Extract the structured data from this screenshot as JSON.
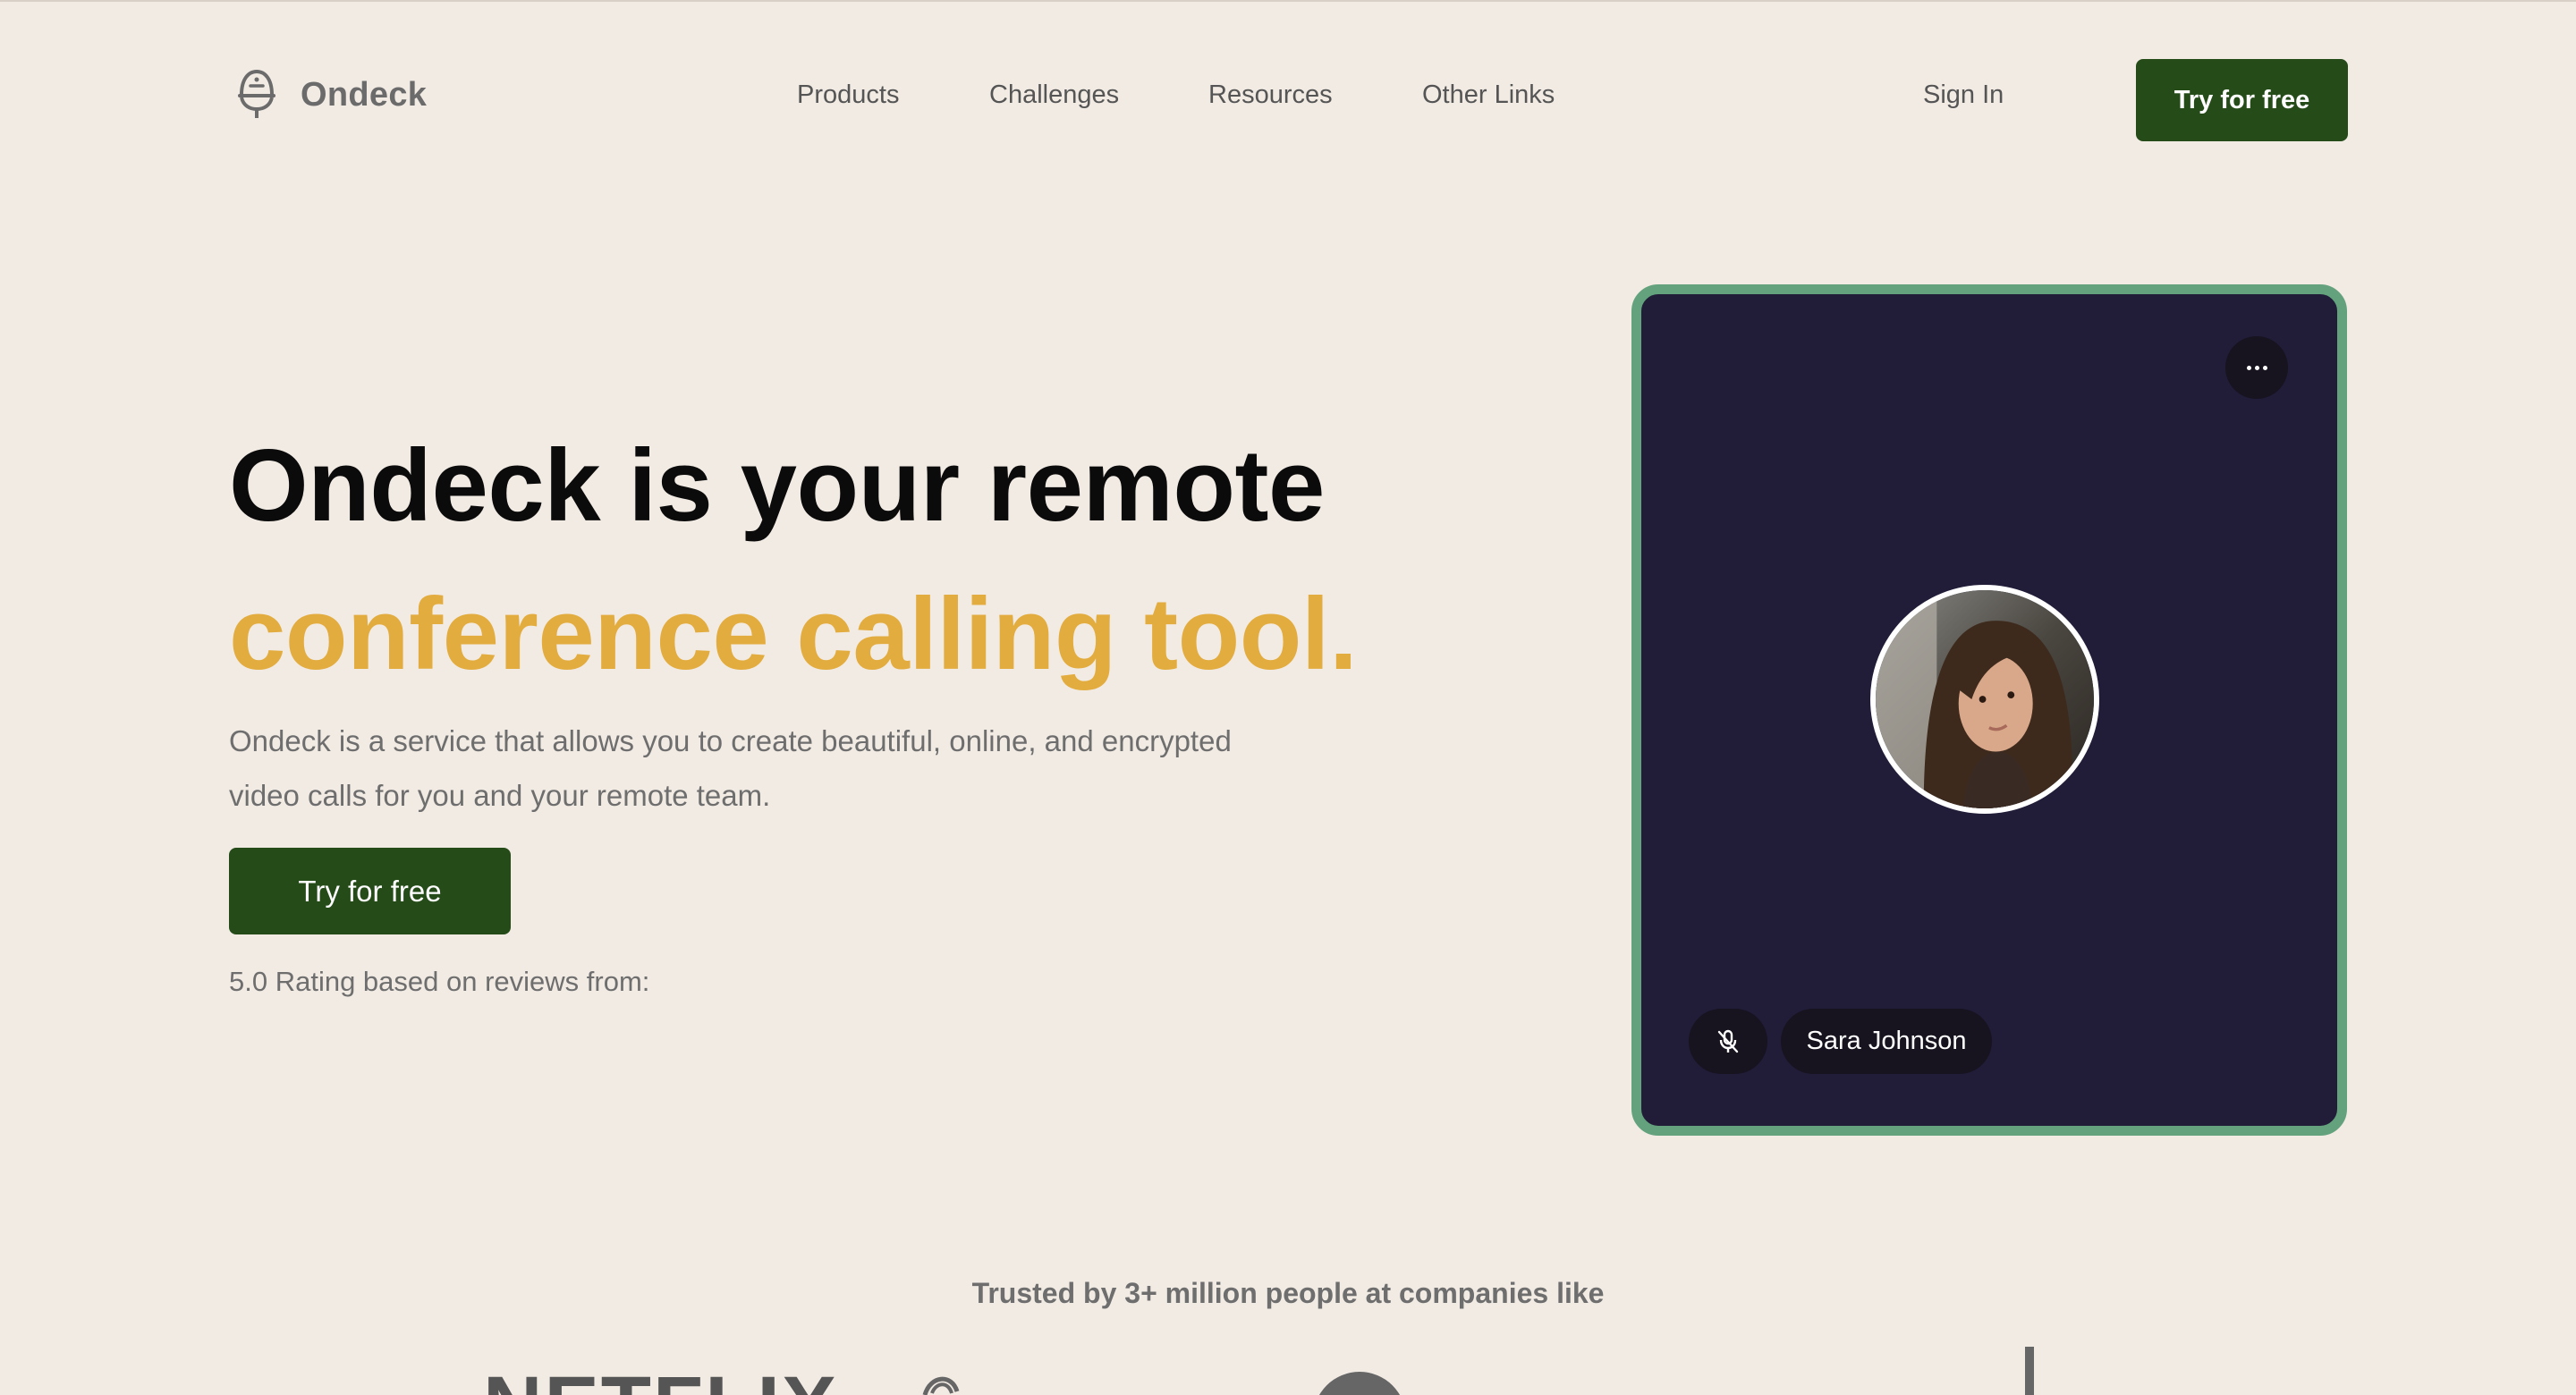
{
  "header": {
    "brand": "Ondeck",
    "nav": [
      "Products",
      "Challenges",
      "Resources",
      "Other Links"
    ],
    "sign_in": "Sign In",
    "cta": "Try for free"
  },
  "hero": {
    "title_line1": "Ondeck is your remote",
    "title_line2": "conference calling tool.",
    "description": "Ondeck is a service that allows you to create beautiful, online, and encrypted video calls for you and your remote team.",
    "cta": "Try for free",
    "rating_text": "5.0 Rating based on reviews from:"
  },
  "call_card": {
    "participant_name": "Sara Johnson",
    "mic_state": "muted",
    "icons": [
      "more-options-icon",
      "mic-off-icon"
    ]
  },
  "trusted": {
    "text": "Trusted by 3+ million people at companies like",
    "logos": [
      "NETFLIX"
    ]
  },
  "colors": {
    "background": "#f2ebe4",
    "primary_button": "#254b19",
    "accent_text": "#e2ac3f",
    "card_background": "#211c38",
    "card_border": "#63a27c"
  }
}
